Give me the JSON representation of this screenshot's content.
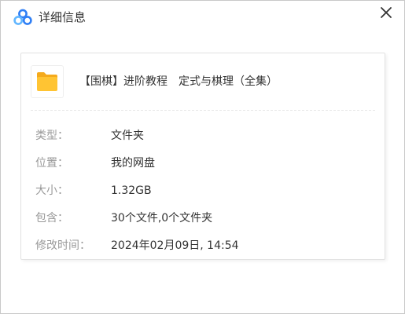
{
  "window": {
    "title": "详细信息"
  },
  "file": {
    "name": "【围棋】进阶教程　定式与棋理（全集）",
    "icon": "folder-icon"
  },
  "details": [
    {
      "label": "类型：",
      "value": "文件夹"
    },
    {
      "label": "位置：",
      "value": "我的网盘"
    },
    {
      "label": "大小：",
      "value": "1.32GB"
    },
    {
      "label": "包含：",
      "value": "30个文件,0个文件夹"
    },
    {
      "label": "修改时间：",
      "value": "2024年02月09日, 14:54"
    }
  ],
  "colors": {
    "logo_blue": "#2f7ff5",
    "logo_light_blue": "#61b6ff",
    "folder_yellow": "#ffc433",
    "folder_tab": "#f5aa1c",
    "label_gray": "#999999",
    "text_dark": "#333333"
  }
}
